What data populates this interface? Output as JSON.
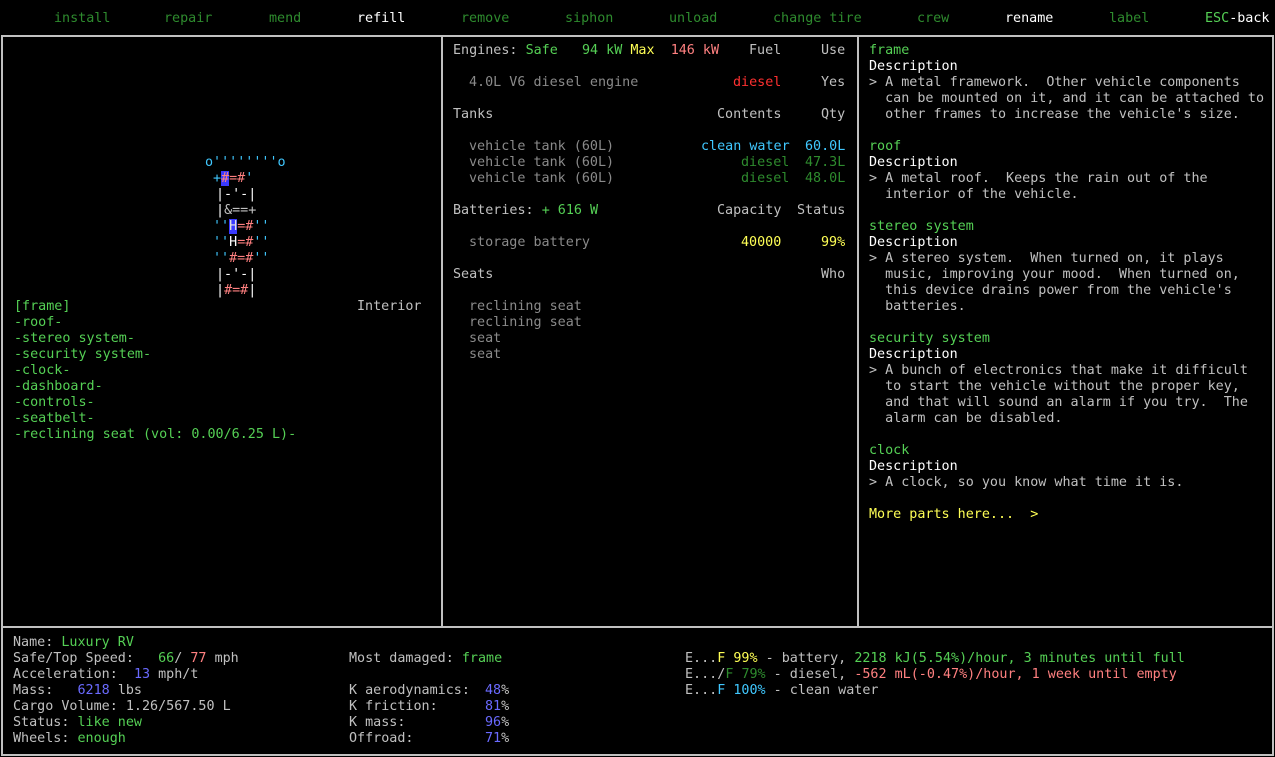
{
  "menu": {
    "install": "install",
    "repair": "repair",
    "mend": "mend",
    "refill": "refill",
    "remove": "remove",
    "siphon": "siphon",
    "unload": "unload",
    "change_tire": "change tire",
    "crew": "crew",
    "rename": "rename",
    "label": "label",
    "esc_key": "ESC",
    "esc_label": "-back"
  },
  "left": {
    "selected_part": "[frame]",
    "location_label": "Interior",
    "parts": [
      "-roof-",
      "-stereo system-",
      "-security system-",
      "-clock-",
      "-dashboard-",
      "-controls-",
      "-seatbelt-",
      "-reclining seat (vol: 0.00/6.25 L)-"
    ]
  },
  "center": {
    "engines_label": "Engines:",
    "engines_status": "Safe",
    "engines_safe_kw": "94 kW",
    "engines_max_label": "Max",
    "engines_max_kw": "146 kW",
    "fuel_header": "Fuel",
    "use_header": "Use",
    "engine_name": "4.0L V6 diesel engine",
    "engine_fuel": "diesel",
    "engine_use": "Yes",
    "tanks_label": "Tanks",
    "contents_header": "Contents",
    "qty_header": "Qty",
    "tanks": [
      {
        "name": "vehicle tank (60L)",
        "contents": "clean water",
        "qty": "60.0L"
      },
      {
        "name": "vehicle tank (60L)",
        "contents": "diesel",
        "qty": "47.3L"
      },
      {
        "name": "vehicle tank (60L)",
        "contents": "diesel",
        "qty": "48.0L"
      }
    ],
    "batteries_label": "Batteries:",
    "batteries_value": "+ 616 W",
    "capacity_header": "Capacity",
    "status_header": "Status",
    "battery_name": "storage battery",
    "battery_capacity": "40000",
    "battery_status": "99%",
    "seats_label": "Seats",
    "who_header": "Who",
    "seats": [
      "reclining seat",
      "reclining seat",
      "seat",
      "seat"
    ]
  },
  "right": {
    "parts": [
      {
        "name": "frame",
        "desc_label": "Description",
        "lines": [
          "> A metal framework.  Other vehicle components",
          "  can be mounted on it, and it can be attached to",
          "  other frames to increase the vehicle's size."
        ]
      },
      {
        "name": "roof",
        "desc_label": "Description",
        "lines": [
          "> A metal roof.  Keeps the rain out of the",
          "  interior of the vehicle."
        ]
      },
      {
        "name": "stereo system",
        "desc_label": "Description",
        "lines": [
          "> A stereo system.  When turned on, it plays",
          "  music, improving your mood.  When turned on,",
          "  this device drains power from the vehicle's",
          "  batteries."
        ]
      },
      {
        "name": "security system",
        "desc_label": "Description",
        "lines": [
          "> A bunch of electronics that make it difficult",
          "  to start the vehicle without the proper key,",
          "  and that will sound an alarm if you try.  The",
          "  alarm can be disabled."
        ]
      },
      {
        "name": "clock",
        "desc_label": "Description",
        "lines": [
          "> A clock, so you know what time it is."
        ]
      }
    ],
    "more": "More parts here...  >"
  },
  "bottom": {
    "name_label": "Name:",
    "name_value": "Luxury RV",
    "speed_label": "Safe/Top Speed:",
    "speed_safe": "66",
    "speed_top": "77",
    "speed_unit": "mph",
    "accel_label": "Acceleration:",
    "accel_value": "13",
    "accel_unit": "mph/t",
    "mass_label": "Mass:",
    "mass_value": "6218",
    "mass_unit": "lbs",
    "cargo_label": "Cargo Volume:",
    "cargo_value": "1.26/567.50 L",
    "status_label": "Status:",
    "status_value": "like new",
    "wheels_label": "Wheels:",
    "wheels_value": "enough",
    "damaged_label": "Most damaged:",
    "damaged_value": "frame",
    "k_aero_label": "K aerodynamics:",
    "k_aero_value": "48",
    "k_fric_label": "K friction:",
    "k_fric_value": "81",
    "k_mass_label": "K mass:",
    "k_mass_value": "96",
    "offroad_label": "Offroad:",
    "offroad_value": "71",
    "pct": "%",
    "fuel_lines": [
      {
        "e": "E...",
        "f": "F",
        "pct": "99%",
        "desc": " - battery, ",
        "rate": "2218 kJ(5.54%)/hour, 3 minutes until full"
      },
      {
        "e": "E.../",
        "f": "F",
        "pct": "79%",
        "desc": " - diesel, ",
        "rate": "-562 mL(-0.47%)/hour, 1 week until empty"
      },
      {
        "e": "E...",
        "f": "F",
        "pct": "100%",
        "desc": " - clean water",
        "rate": ""
      }
    ]
  },
  "colors": {
    "background": "#000000",
    "border": "#c0c0c0",
    "green": "#55d055",
    "dark_green": "#2e8b2e",
    "red": "#ff3030",
    "yellow": "#ffff55",
    "cyan": "#40c8ff",
    "blue": "#6a6aff",
    "pink": "#ff8080"
  }
}
